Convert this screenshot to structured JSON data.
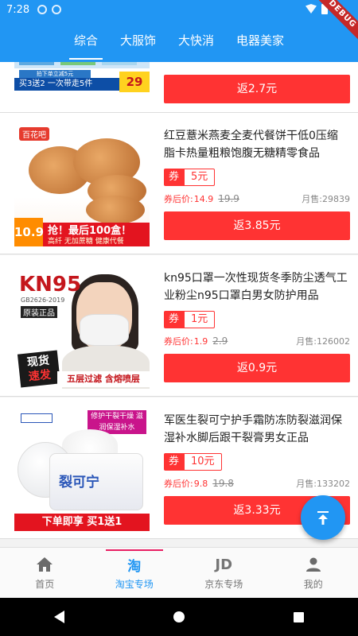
{
  "status_bar": {
    "time": "7:28",
    "debug": "DEBUG"
  },
  "tabs": [
    {
      "label": "综合",
      "active": true
    },
    {
      "label": "大服饰",
      "active": false
    },
    {
      "label": "大快消",
      "active": false
    },
    {
      "label": "电器美家",
      "active": false
    }
  ],
  "partial_item": {
    "thumb_text1": "拍下单立减5元",
    "thumb_text2": "买3送2 一次带走5件",
    "thumb_price": "29",
    "rebate": "返2.7元"
  },
  "items": [
    {
      "title": "红豆薏米燕麦全麦代餐饼干低0压缩脂卡热量粗粮饱腹无糖精零食品",
      "coupon_tag": "券",
      "coupon_amount": "5元",
      "after_label": "券后价:",
      "after_price": "14.9",
      "original_price": "19.9",
      "sales": "月售:29839",
      "rebate": "返3.85元",
      "thumb": {
        "brand": "百花吧",
        "price": "10.9",
        "promo": "抢！最后100盒！",
        "promo_sub": "高纤 无加蔗糖 健康代餐"
      }
    },
    {
      "title": "kn95口罩一次性现货冬季防尘透气工业粉尘n95口罩白男女防护用品",
      "coupon_tag": "券",
      "coupon_amount": "1元",
      "after_label": "券后价:",
      "after_price": "1.9",
      "original_price": "2.9",
      "sales": "月售:126002",
      "rebate": "返0.9元",
      "thumb": {
        "logo": "KN95",
        "standard": "GB2626-2019",
        "genuine": "原装正品",
        "stock1": "现货",
        "stock2": "速发",
        "bottom": "五层过滤 含熔喷层"
      }
    },
    {
      "title": "军医生裂可宁护手霜防冻防裂滋润保湿补水脚后跟干裂膏男女正品",
      "coupon_tag": "券",
      "coupon_amount": "10元",
      "after_label": "券后价:",
      "after_price": "9.8",
      "original_price": "19.8",
      "sales": "月售:133202",
      "rebate": "返3.33元",
      "thumb": {
        "tag": "修护干裂干燥 滋润保湿补水",
        "label": "裂可宁",
        "bottom": "下单即享 买1送1"
      }
    }
  ],
  "bottom_nav": [
    {
      "label": "首页",
      "icon": "home-icon",
      "active": false
    },
    {
      "label": "淘宝专场",
      "icon": "taobao-icon",
      "glyph": "淘",
      "active": true
    },
    {
      "label": "京东专场",
      "icon": "jd-icon",
      "glyph": "JD",
      "active": false
    },
    {
      "label": "我的",
      "icon": "person-icon",
      "active": false
    }
  ],
  "colors": {
    "primary": "#2196f3",
    "accent": "#ff3333",
    "active_indicator": "#e91e63"
  }
}
